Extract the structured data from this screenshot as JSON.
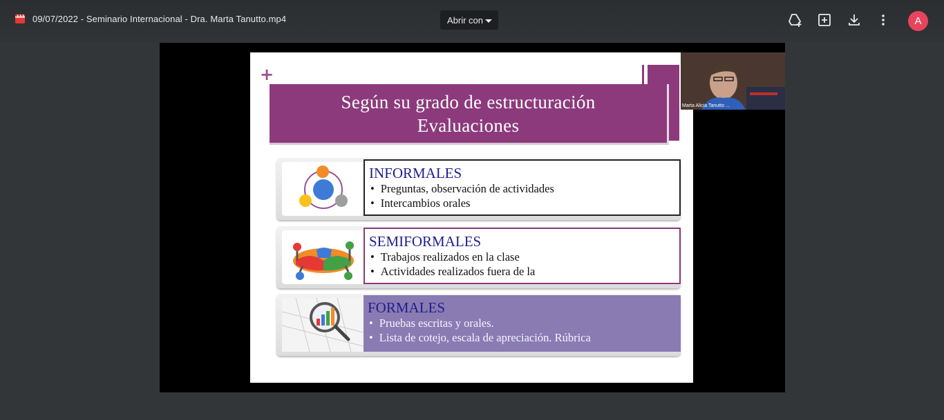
{
  "header": {
    "file_name": "09/07/2022 - Seminario Internacional - Dra. Marta Tanutto.mp4",
    "open_with_label": "Abrir con",
    "avatar_initial": "A",
    "icons": [
      "add-to-drive-icon",
      "new-window-icon",
      "download-icon",
      "more-options-icon"
    ]
  },
  "slide": {
    "title_line1": "Según su grado de estructuración",
    "title_line2": "Evaluaciones",
    "sections": [
      {
        "heading": "INFORMALES",
        "items": [
          "Preguntas, observación de actividades",
          "Intercambios orales"
        ]
      },
      {
        "heading": "SEMIFORMALES",
        "items": [
          "Trabajos realizados en la clase",
          "Actividades realizados fuera de la"
        ]
      },
      {
        "heading": "FORMALES",
        "items": [
          "Pruebas escritas y orales.",
          "Lista de cotejo, escala de apreciación. Rúbrica"
        ]
      }
    ]
  },
  "webcam": {
    "participant_name": "Marta Alicia Tanutto ..."
  },
  "colors": {
    "slide_accent": "#8c3a7c",
    "heading_blue": "#1e1e8c",
    "formales_box": "#8a7bb3",
    "avatar": "#e8445d"
  }
}
